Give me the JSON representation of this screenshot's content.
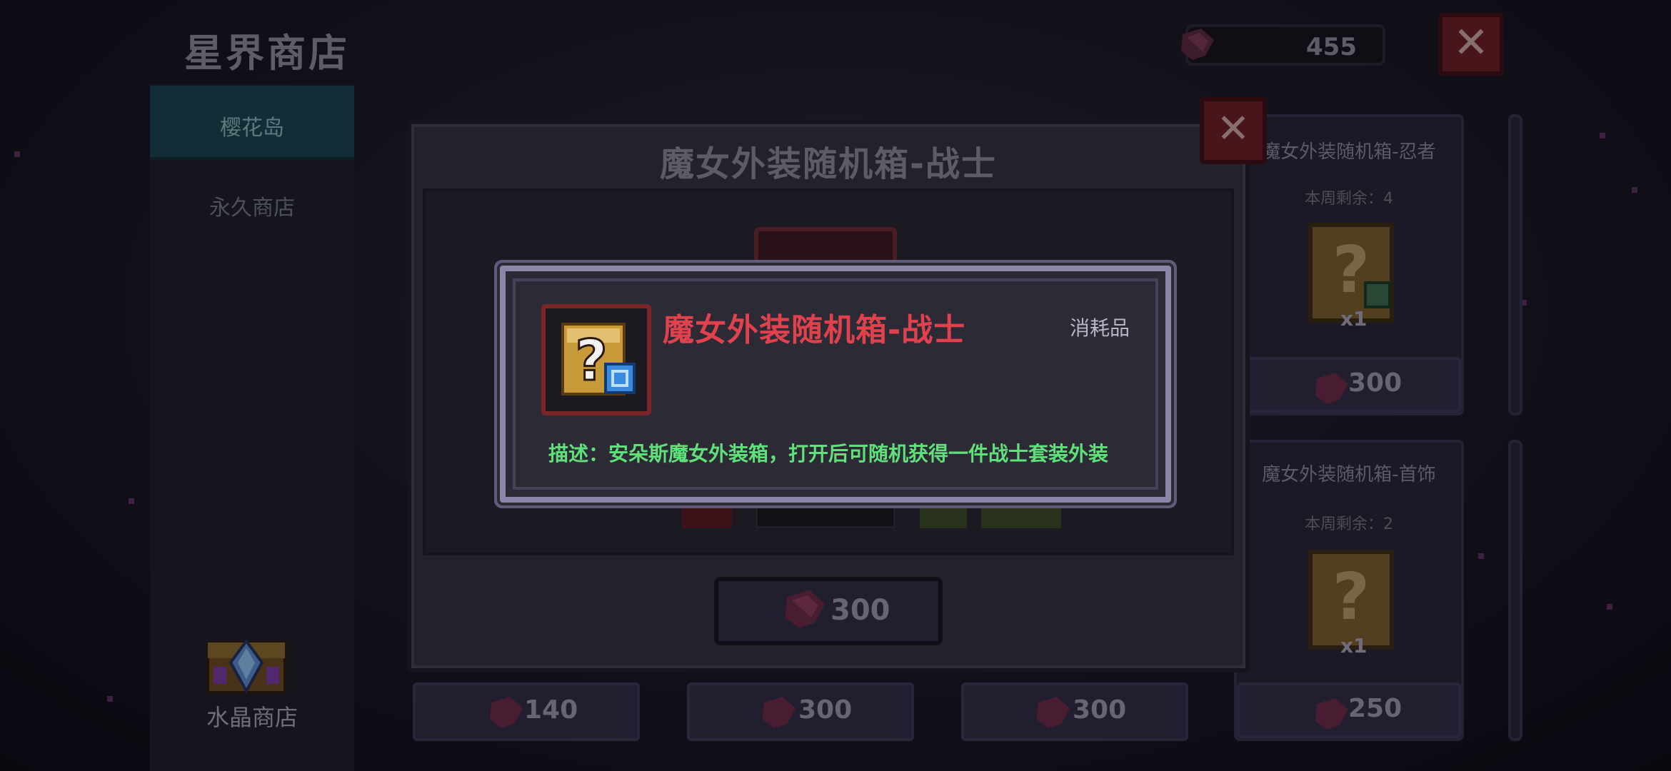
{
  "header": {
    "title": "星界商店",
    "currency": "455",
    "close_icon": "close-icon"
  },
  "sidebar": {
    "tabs": [
      {
        "label": "樱花岛",
        "active": true
      },
      {
        "label": "永久商店",
        "active": false
      }
    ],
    "crystal_shop_label": "水晶商店"
  },
  "right_cards": [
    {
      "title": "魔女外装随机箱-忍者",
      "remaining": "本周剩余：4",
      "qty": "x1",
      "price": "300"
    },
    {
      "title": "魔女外装随机箱-首饰",
      "remaining": "本周剩余：2",
      "qty": "x1",
      "price": "250"
    }
  ],
  "bottom_prices": [
    "140",
    "300",
    "300"
  ],
  "purchase_dialog": {
    "title": "魔女外装随机箱-战士",
    "buy_price": "300"
  },
  "tooltip": {
    "item_name": "魔女外装随机箱-战士",
    "item_type": "消耗品",
    "description": "描述：安朵斯魔女外装箱，打开后可随机获得一件战士套装外装"
  },
  "colors": {
    "accent_red": "#e0424d",
    "desc_green": "#5fe07a",
    "active_tab": "#17434a",
    "gem": "#8a2a50"
  }
}
